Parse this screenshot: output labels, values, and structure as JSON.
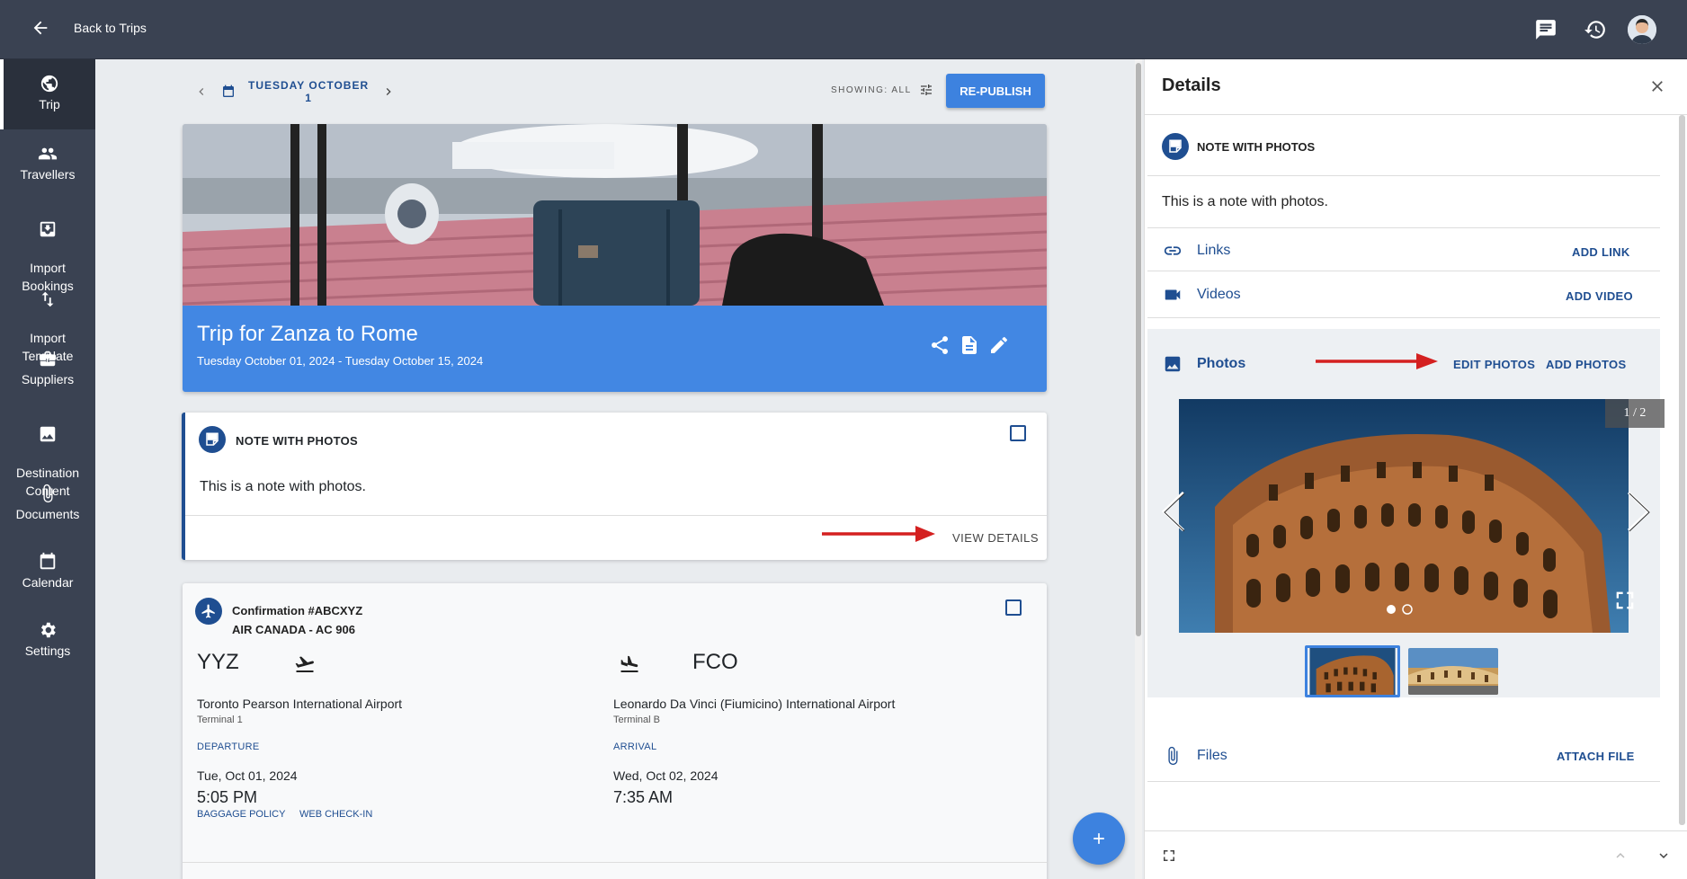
{
  "topbar": {
    "back_label": "Back to Trips",
    "icons": [
      "back-arrow-icon",
      "chat-icon",
      "history-icon",
      "avatar"
    ]
  },
  "sidebar": {
    "items": [
      {
        "label": "Trip",
        "icon": "globe-icon",
        "active": true
      },
      {
        "label": "Travellers",
        "icon": "people-icon"
      },
      {
        "label": "Import\nBookings",
        "icon": "import-icon"
      },
      {
        "label": "Import\nTemplate",
        "icon": "sort-arrows-icon"
      },
      {
        "label": "Suppliers",
        "icon": "briefcase-icon"
      },
      {
        "label": "Destination\nContent",
        "icon": "image-icon"
      },
      {
        "label": "Documents",
        "icon": "paperclip-icon"
      },
      {
        "label": "Calendar",
        "icon": "calendar-icon"
      },
      {
        "label": "Settings",
        "icon": "gear-icon"
      }
    ]
  },
  "main": {
    "date_line1": "TUESDAY OCTOBER",
    "date_line2": "1",
    "showing": "SHOWING: ALL",
    "republish": "RE-PUBLISH",
    "trip_title": "Trip for Zanza to Rome",
    "trip_dates": "Tuesday October 01, 2024 - Tuesday October 15, 2024",
    "note": {
      "title": "NOTE WITH PHOTOS",
      "text": "This is a note with photos.",
      "view_details": "VIEW DETAILS"
    },
    "flight": {
      "confirmation": "Confirmation #ABCXYZ",
      "carrier": "AIR CANADA - AC 906",
      "departure": {
        "code": "YYZ",
        "airport": "Toronto Pearson International Airport",
        "terminal": "Terminal 1",
        "label": "DEPARTURE",
        "date": "Tue, Oct 01, 2024",
        "time": "5:05 PM"
      },
      "arrival": {
        "code": "FCO",
        "airport": "Leonardo Da Vinci (Fiumicino) International Airport",
        "terminal": "Terminal B",
        "label": "ARRIVAL",
        "date": "Wed, Oct 02, 2024",
        "time": "7:35 AM"
      },
      "links": [
        "BAGGAGE POLICY",
        "WEB CHECK-IN"
      ]
    }
  },
  "details": {
    "title": "Details",
    "note_title": "NOTE WITH PHOTOS",
    "note_text": "This is a note with photos.",
    "links": {
      "label": "Links",
      "action": "ADD LINK"
    },
    "videos": {
      "label": "Videos",
      "action": "ADD VIDEO"
    },
    "photos": {
      "label": "Photos",
      "edit": "EDIT PHOTOS",
      "add": "ADD PHOTOS",
      "counter": "1 / 2",
      "current": 1,
      "total": 2
    },
    "files": {
      "label": "Files",
      "action": "ATTACH FILE"
    }
  },
  "colors": {
    "topbar": "#3a4252",
    "primary": "#1f4e91",
    "accent": "#3d82df",
    "hero_band": "#4287e3",
    "annotation_arrow": "#d42020"
  }
}
